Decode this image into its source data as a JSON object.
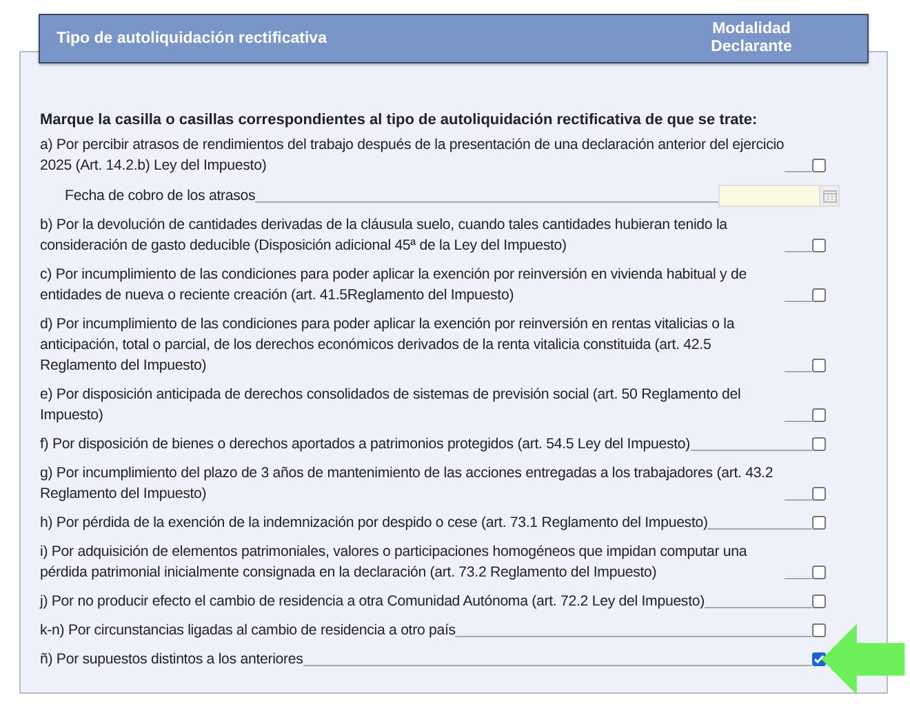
{
  "header": {
    "title": "Tipo de autoliquidación rectificativa",
    "column_label": "Modalidad Declarante"
  },
  "instruction": "Marque la casilla o casillas correspondientes al tipo de autoliquidación rectificativa de que se trate:",
  "items": [
    {
      "kind": "check",
      "label": "a) Por percibir atrasos de rendimientos del trabajo después de la presentación de una declaración anterior del ejercicio 2025 (Art. 14.2.b) Ley del Impuesto)",
      "checked": false
    },
    {
      "kind": "date",
      "label": "Fecha de cobro de los atrasos",
      "disabled": true
    },
    {
      "kind": "check",
      "label": "b) Por la devolución de cantidades derivadas de la cláusula suelo, cuando tales cantidades hubieran tenido la consideración de gasto deducible (Disposición adicional 45ª de la Ley del Impuesto)",
      "checked": false
    },
    {
      "kind": "check",
      "label": "c) Por incumplimiento de las condiciones para poder aplicar la exención por reinversión en vivienda habitual y de entidades de nueva o reciente creación (art. 41.5Reglamento del Impuesto)",
      "checked": false
    },
    {
      "kind": "check",
      "label": "d) Por incumplimiento de las condiciones para poder aplicar la exención por reinversión en rentas vitalicias o la anticipación, total o parcial, de los derechos económicos derivados de la renta vitalicia constituida (art. 42.5 Reglamento del Impuesto)",
      "checked": false
    },
    {
      "kind": "check",
      "label": "e) Por disposición anticipada de derechos consolidados de sistemas de previsión social (art. 50 Reglamento del Impuesto)",
      "checked": false
    },
    {
      "kind": "check",
      "label": "f) Por disposición de bienes o derechos aportados a patrimonios protegidos (art. 54.5 Ley del Impuesto)",
      "checked": false
    },
    {
      "kind": "check",
      "label": "g) Por incumplimiento del plazo de 3 años de mantenimiento de las acciones entregadas a los trabajadores (art. 43.2 Reglamento del Impuesto)",
      "checked": false
    },
    {
      "kind": "check",
      "label": "h) Por pérdida de la exención de la indemnización por despido o cese (art. 73.1 Reglamento del Impuesto)",
      "checked": false
    },
    {
      "kind": "check",
      "label": "i) Por adquisición de elementos patrimoniales, valores o participaciones homogéneos que impidan computar una pérdida patrimonial inicialmente consignada en la declaración (art. 73.2 Reglamento del Impuesto)",
      "checked": false
    },
    {
      "kind": "check",
      "label": "j) Por no producir efecto el cambio de residencia a otra Comunidad Autónoma (art. 72.2 Ley del Impuesto)",
      "checked": false
    },
    {
      "kind": "check",
      "label": "k-n) Por circunstancias ligadas al cambio de residencia a otro país",
      "checked": false
    },
    {
      "kind": "check",
      "label": "ñ) Por supuestos distintos a los anteriores",
      "checked": true
    }
  ]
}
